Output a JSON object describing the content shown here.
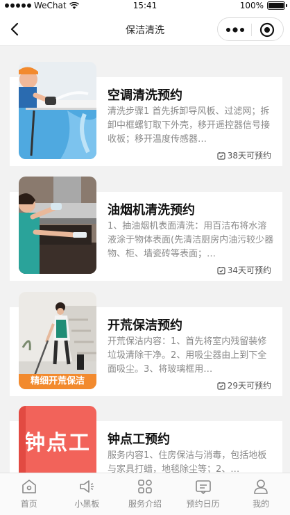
{
  "status_bar": {
    "carrier": "WeChat",
    "time": "15:41",
    "battery": "100%"
  },
  "nav": {
    "title": "保洁清洗"
  },
  "services": [
    {
      "title": "空调清洗预约",
      "description": "清洗步骤1 首先拆卸导风板、过滤网；拆卸中框螺钉取下外壳，移开遥控器信号接收板；移开温度传感器…",
      "availability": "38天可预约"
    },
    {
      "title": "油烟机清洗预约",
      "description": "1、抽油烟机表面清洗：用百洁布将水溶液涂于物体表面(先清洁厨房内油污较少器物、柜、墙瓷砖等表面；…",
      "availability": "34天可预约"
    },
    {
      "title": "开荒保洁预约",
      "description": "开荒保洁内容：1、首先将室内残留装修垃圾清除干净。2、用吸尘器由上到下全面吸尘。3、将玻璃框用…",
      "availability": "29天可预约",
      "image_caption": "精细开荒保洁"
    },
    {
      "title": "钟点工预约",
      "description": "服务内容1、住房保洁与消毒，包括地板与家具打蜡，地毯除尘等；2、…",
      "image_caption": "钟点工"
    }
  ],
  "tabbar": [
    {
      "label": "首页",
      "icon": "home-icon"
    },
    {
      "label": "小黑板",
      "icon": "megaphone-icon"
    },
    {
      "label": "服务介绍",
      "icon": "grid-icon"
    },
    {
      "label": "预约日历",
      "icon": "calendar-chat-icon"
    },
    {
      "label": "我的",
      "icon": "user-icon"
    }
  ],
  "colors": {
    "accent_orange": "#f28a2e",
    "coral": "#f2635a",
    "text_dark": "#111111",
    "text_gray": "#8a8a8a"
  }
}
